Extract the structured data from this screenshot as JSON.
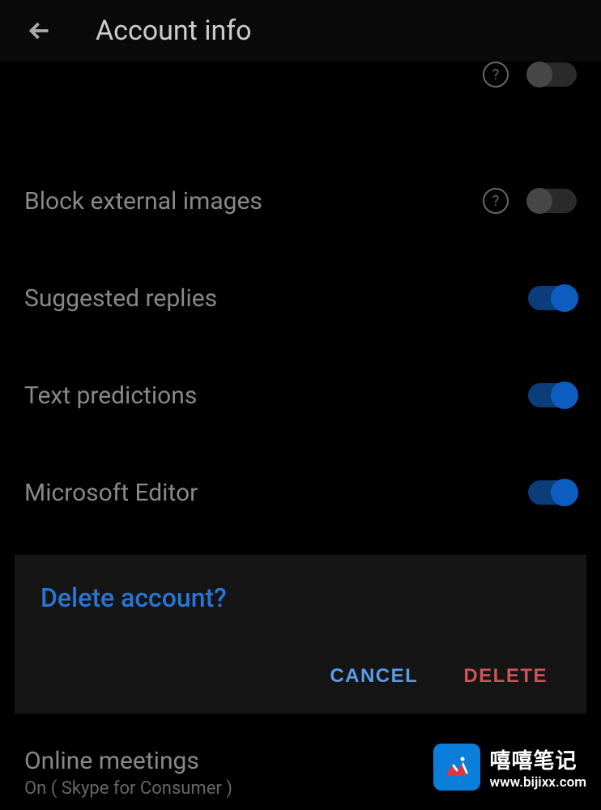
{
  "header": {
    "title": "Account info"
  },
  "settings": [
    {
      "label": "Block external images",
      "hasHelp": true,
      "toggle": "off"
    },
    {
      "label": "Suggested replies",
      "hasHelp": false,
      "toggle": "on"
    },
    {
      "label": "Text predictions",
      "hasHelp": false,
      "toggle": "on"
    },
    {
      "label": "Microsoft Editor",
      "hasHelp": false,
      "toggle": "on"
    }
  ],
  "dialog": {
    "title": "Delete account?",
    "cancelLabel": "CANCEL",
    "deleteLabel": "DELETE"
  },
  "bottomSection": {
    "title": "Online meetings",
    "subtitle": "On ( Skype for Consumer )"
  },
  "watermark": {
    "cnText": "嘻嘻笔记",
    "url": "www.bijixx.com"
  }
}
